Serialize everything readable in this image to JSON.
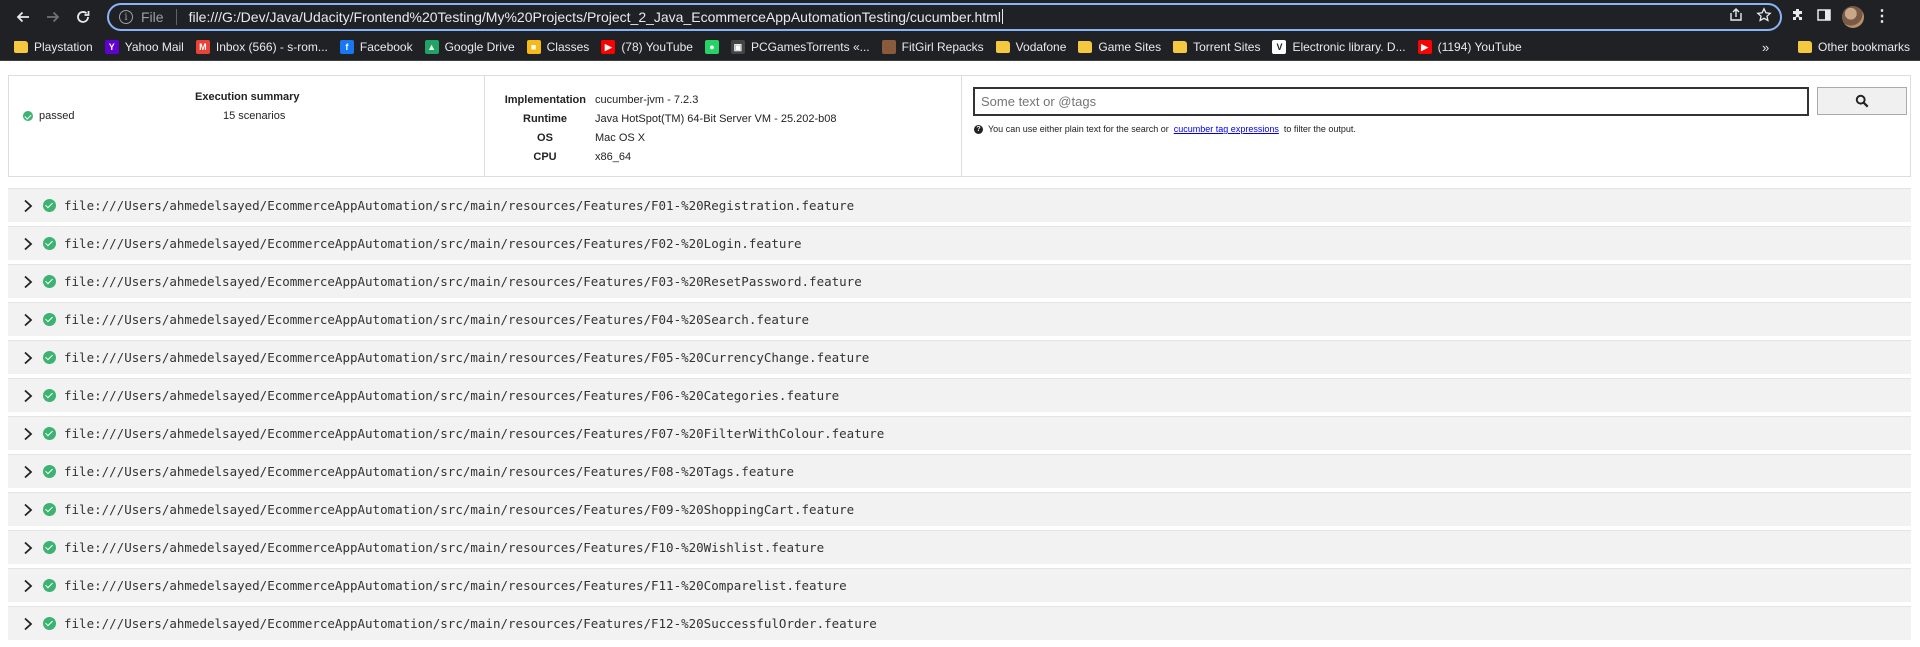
{
  "browser": {
    "scheme_label": "File",
    "url": "file:///G:/Dev/Java/Udacity/Frontend%20Testing/My%20Projects/Project_2_Java_EcommerceAppAutomationTesting/cucumber.html",
    "bookmarks": [
      {
        "label": "Playstation",
        "icon": "folder-icon"
      },
      {
        "label": "Yahoo Mail",
        "icon": "yahoo-icon"
      },
      {
        "label": "Inbox (566) - s-rom...",
        "icon": "gmail-icon"
      },
      {
        "label": "Facebook",
        "icon": "facebook-icon"
      },
      {
        "label": "Google Drive",
        "icon": "drive-icon"
      },
      {
        "label": "Classes",
        "icon": "classroom-icon"
      },
      {
        "label": "(78) YouTube",
        "icon": "youtube-icon"
      },
      {
        "label": "",
        "icon": "whatsapp-icon"
      },
      {
        "label": "PCGamesTorrents «...",
        "icon": "pcgames-icon"
      },
      {
        "label": "FitGirl Repacks",
        "icon": "fitgirl-icon"
      },
      {
        "label": "Vodafone",
        "icon": "folder-icon"
      },
      {
        "label": "Game Sites",
        "icon": "folder-icon"
      },
      {
        "label": "Torrent Sites",
        "icon": "folder-icon"
      },
      {
        "label": "Electronic library. D...",
        "icon": "library-icon"
      },
      {
        "label": "(1194) YouTube",
        "icon": "youtube-icon"
      }
    ],
    "other_bookmarks": "Other bookmarks",
    "more_chevron": "»"
  },
  "summary": {
    "title": "Execution summary",
    "status": "passed",
    "scenarios": "15 scenarios",
    "env": {
      "implementation_label": "Implementation",
      "implementation": "cucumber-jvm - 7.2.3",
      "runtime_label": "Runtime",
      "runtime": "Java HotSpot(TM) 64-Bit Server VM - 25.202-b08",
      "os_label": "OS",
      "os": "Mac OS X",
      "cpu_label": "CPU",
      "cpu": "x86_64"
    },
    "search": {
      "placeholder": "Some text or @tags",
      "help_before": "You can use either plain text for the search or",
      "help_link": "cucumber tag expressions",
      "help_after": "to filter the output."
    }
  },
  "features": [
    "file:///Users/ahmedelsayed/EcommerceAppAutomation/src/main/resources/Features/F01-%20Registration.feature",
    "file:///Users/ahmedelsayed/EcommerceAppAutomation/src/main/resources/Features/F02-%20Login.feature",
    "file:///Users/ahmedelsayed/EcommerceAppAutomation/src/main/resources/Features/F03-%20ResetPassword.feature",
    "file:///Users/ahmedelsayed/EcommerceAppAutomation/src/main/resources/Features/F04-%20Search.feature",
    "file:///Users/ahmedelsayed/EcommerceAppAutomation/src/main/resources/Features/F05-%20CurrencyChange.feature",
    "file:///Users/ahmedelsayed/EcommerceAppAutomation/src/main/resources/Features/F06-%20Categories.feature",
    "file:///Users/ahmedelsayed/EcommerceAppAutomation/src/main/resources/Features/F07-%20FilterWithColour.feature",
    "file:///Users/ahmedelsayed/EcommerceAppAutomation/src/main/resources/Features/F08-%20Tags.feature",
    "file:///Users/ahmedelsayed/EcommerceAppAutomation/src/main/resources/Features/F09-%20ShoppingCart.feature",
    "file:///Users/ahmedelsayed/EcommerceAppAutomation/src/main/resources/Features/F10-%20Wishlist.feature",
    "file:///Users/ahmedelsayed/EcommerceAppAutomation/src/main/resources/Features/F11-%20Comparelist.feature",
    "file:///Users/ahmedelsayed/EcommerceAppAutomation/src/main/resources/Features/F12-%20SuccessfulOrder.feature"
  ],
  "colors": {
    "passed": "#3cb371",
    "chrome_bg": "#202124",
    "focus_ring": "#8ab4f8"
  }
}
